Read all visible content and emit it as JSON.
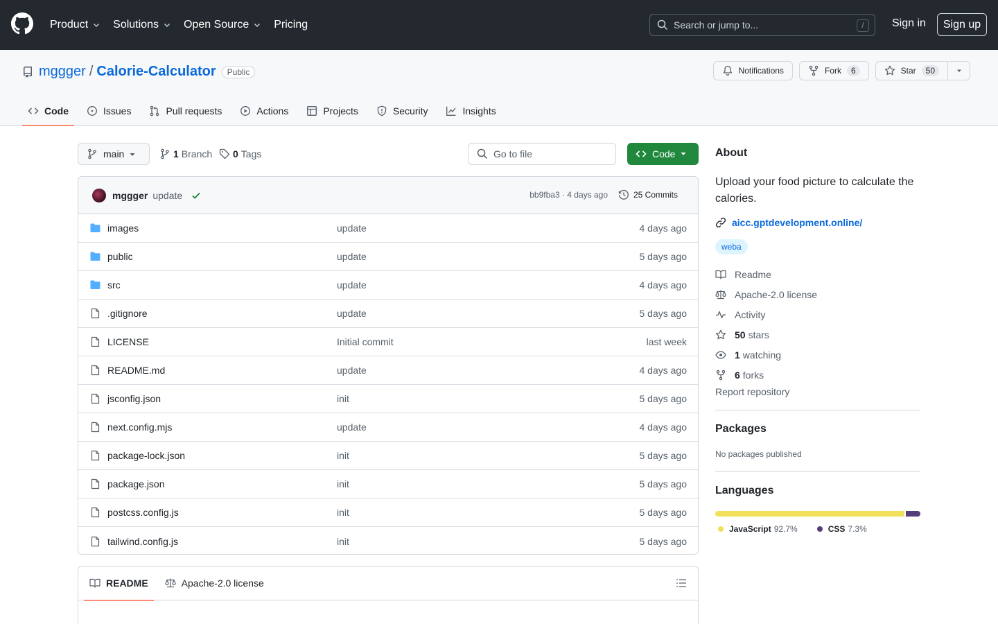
{
  "header": {
    "nav": [
      "Product",
      "Solutions",
      "Open Source",
      "Pricing"
    ],
    "search_placeholder": "Search or jump to...",
    "search_shortcut": "/",
    "sign_in": "Sign in",
    "sign_up": "Sign up"
  },
  "repo": {
    "owner": "mggger",
    "separator": "/",
    "name": "Calorie-Calculator",
    "visibility": "Public",
    "notifications_label": "Notifications",
    "fork_label": "Fork",
    "fork_count": "6",
    "star_label": "Star",
    "star_count": "50"
  },
  "tabs": [
    {
      "label": "Code",
      "icon": "code-icon",
      "active": true
    },
    {
      "label": "Issues",
      "icon": "issue-icon"
    },
    {
      "label": "Pull requests",
      "icon": "pull-request-icon"
    },
    {
      "label": "Actions",
      "icon": "play-icon"
    },
    {
      "label": "Projects",
      "icon": "table-icon"
    },
    {
      "label": "Security",
      "icon": "shield-icon"
    },
    {
      "label": "Insights",
      "icon": "graph-icon"
    }
  ],
  "toolbar": {
    "branch": "main",
    "branch_count": "1",
    "branch_label": "Branch",
    "tag_count": "0",
    "tag_label": "Tags",
    "goto_placeholder": "Go to file",
    "code_button": "Code"
  },
  "commit": {
    "author": "mggger",
    "message": "update",
    "sha_time": "bb9fba3 · 4 days ago",
    "commits": "25 Commits"
  },
  "files": [
    {
      "type": "dir",
      "name": "images",
      "message": "update",
      "date": "4 days ago"
    },
    {
      "type": "dir",
      "name": "public",
      "message": "update",
      "date": "5 days ago"
    },
    {
      "type": "dir",
      "name": "src",
      "message": "update",
      "date": "4 days ago"
    },
    {
      "type": "file",
      "name": ".gitignore",
      "message": "update",
      "date": "5 days ago"
    },
    {
      "type": "file",
      "name": "LICENSE",
      "message": "Initial commit",
      "date": "last week"
    },
    {
      "type": "file",
      "name": "README.md",
      "message": "update",
      "date": "4 days ago"
    },
    {
      "type": "file",
      "name": "jsconfig.json",
      "message": "init",
      "date": "5 days ago"
    },
    {
      "type": "file",
      "name": "next.config.mjs",
      "message": "update",
      "date": "4 days ago"
    },
    {
      "type": "file",
      "name": "package-lock.json",
      "message": "init",
      "date": "5 days ago"
    },
    {
      "type": "file",
      "name": "package.json",
      "message": "init",
      "date": "5 days ago"
    },
    {
      "type": "file",
      "name": "postcss.config.js",
      "message": "init",
      "date": "5 days ago"
    },
    {
      "type": "file",
      "name": "tailwind.config.js",
      "message": "init",
      "date": "5 days ago"
    }
  ],
  "readme_tabs": [
    "README",
    "Apache-2.0 license"
  ],
  "about": {
    "title": "About",
    "description": "Upload your food picture to calculate the calories.",
    "link": "aicc.gptdevelopment.online/",
    "topic": "weba",
    "readme": "Readme",
    "license": "Apache-2.0 license",
    "activity": "Activity",
    "stars_count": "50",
    "stars_label": "stars",
    "watching_count": "1",
    "watching_label": "watching",
    "forks_count": "6",
    "forks_label": "forks",
    "report": "Report repository"
  },
  "packages": {
    "title": "Packages",
    "text": "No packages published"
  },
  "languages": {
    "title": "Languages",
    "items": [
      {
        "name": "JavaScript",
        "percent": "92.7%",
        "fraction": 0.927,
        "color": "#f1e05a"
      },
      {
        "name": "CSS",
        "percent": "7.3%",
        "fraction": 0.073,
        "color": "#563d7c"
      }
    ]
  },
  "colors": {
    "header_bg": "#24292f",
    "link": "#0969da",
    "primary_button": "#1f883d",
    "active_tab_underline": "#fd8c73",
    "folder": "#54aeff"
  }
}
